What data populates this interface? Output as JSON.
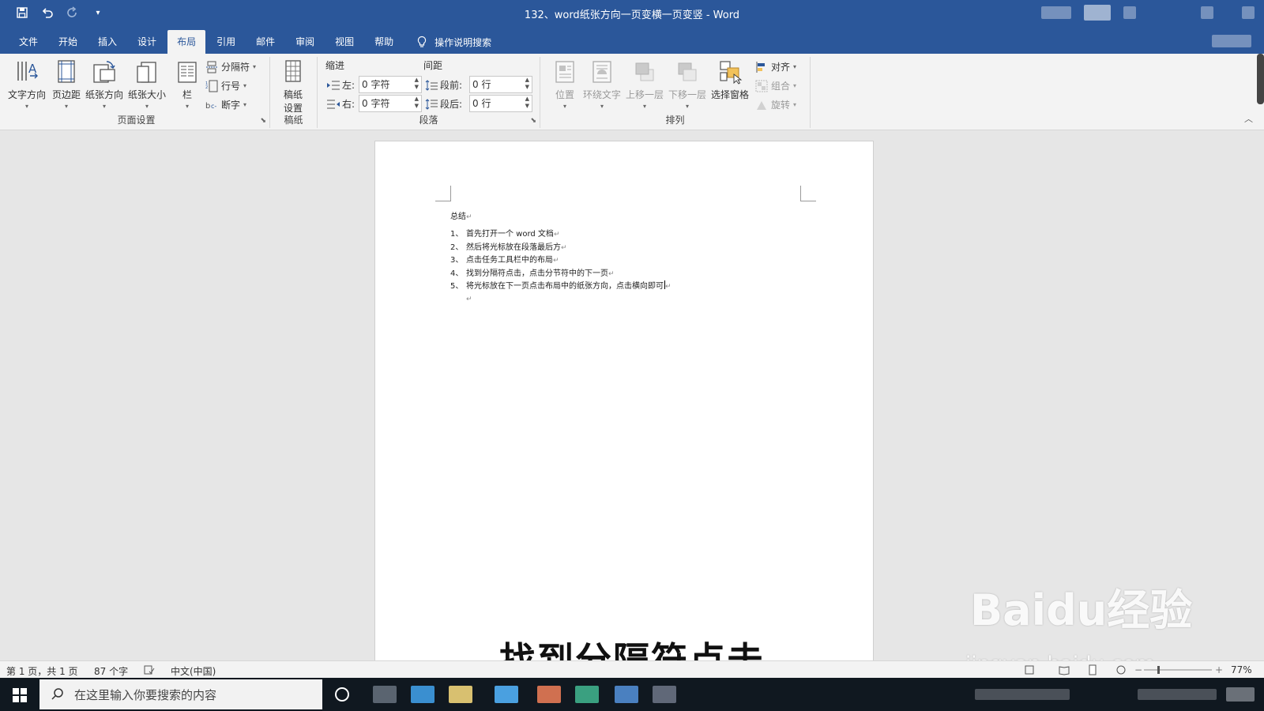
{
  "titlebar": {
    "document_title": "132、word纸张方向一页变横一页变竖 - Word",
    "qat_icons": [
      "save-icon",
      "undo-icon",
      "redo-icon",
      "customize-icon"
    ]
  },
  "tabs": [
    {
      "label": "文件"
    },
    {
      "label": "开始"
    },
    {
      "label": "插入"
    },
    {
      "label": "设计"
    },
    {
      "label": "布局",
      "active": true
    },
    {
      "label": "引用"
    },
    {
      "label": "邮件"
    },
    {
      "label": "审阅"
    },
    {
      "label": "视图"
    },
    {
      "label": "帮助"
    }
  ],
  "tell_me": "操作说明搜索",
  "ribbon": {
    "page_setup": {
      "label": "页面设置",
      "text_direction": "文字方向",
      "margins": "页边距",
      "orientation": "纸张方向",
      "size": "纸张大小",
      "columns": "栏",
      "breaks": "分隔符",
      "line_numbers": "行号",
      "hyphenation": "断字"
    },
    "manuscript": {
      "label": "稿纸",
      "button": "稿纸\n设置",
      "button_line1": "稿纸",
      "button_line2": "设置"
    },
    "paragraph": {
      "label": "段落",
      "indent_head": "缩进",
      "spacing_head": "间距",
      "left_label": "左:",
      "left_value": "0 字符",
      "right_label": "右:",
      "right_value": "0 字符",
      "before_label": "段前:",
      "before_value": "0 行",
      "after_label": "段后:",
      "after_value": "0 行"
    },
    "arrange": {
      "label": "排列",
      "position": "位置",
      "wrap_text": "环绕文字",
      "bring_forward": "上移一层",
      "send_backward": "下移一层",
      "selection_pane": "选择窗格",
      "align": "对齐",
      "group": "组合",
      "rotate": "旋转"
    }
  },
  "document": {
    "heading": "总结",
    "items": [
      {
        "num": "1、",
        "text": "首先打开一个 word 文档"
      },
      {
        "num": "2、",
        "text": "然后将光标放在段落最后方"
      },
      {
        "num": "3、",
        "text": "点击任务工具栏中的布局"
      },
      {
        "num": "4、",
        "text": "找到分隔符点击，点击分节符中的下一页"
      },
      {
        "num": "5、",
        "text": "将光标放在下一页点击布局中的纸张方向，点击横向即可"
      }
    ],
    "paragraph_mark": "↵"
  },
  "subtitle": "找到分隔符点击",
  "watermark": {
    "main": "Baidu经验",
    "url": "jingyan.baidu.com"
  },
  "statusbar": {
    "page": "第 1 页，共 1 页",
    "words": "87 个字",
    "language": "中文(中国)",
    "zoom": "77%"
  },
  "taskbar": {
    "search_placeholder": "在这里输入你要搜索的内容"
  },
  "colors": {
    "word_blue": "#2b579a",
    "ribbon_bg": "#f3f3f3",
    "canvas_bg": "#e6e6e6",
    "taskbar_bg": "#101820"
  }
}
